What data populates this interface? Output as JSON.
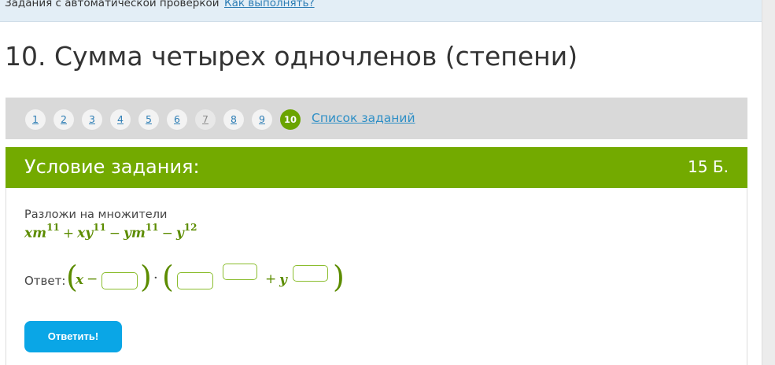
{
  "topbar": {
    "crumb": "Задания с автоматической проверкой",
    "help_link": "Как выполнять?"
  },
  "page_title": "10. Сумма четырех одночленов (степени)",
  "task_nav": {
    "items": [
      "1",
      "2",
      "3",
      "4",
      "5",
      "6",
      "7",
      "8",
      "9",
      "10"
    ],
    "active": "10",
    "list_link": "Список заданий"
  },
  "card": {
    "title": "Условие задания:",
    "points": "15 Б.",
    "prompt": "Разложи на множители",
    "expression": {
      "t1_base": "xm",
      "t1_exp": "11",
      "op1": "+",
      "t2_base": "xy",
      "t2_exp": "11",
      "op2": "−",
      "t3_base": "ym",
      "t3_exp": "11",
      "op3": "−",
      "t4_base": "y",
      "t4_exp": "12"
    },
    "answer_label": "Ответ:",
    "answer": {
      "x": "x",
      "minus": "−",
      "dot": "·",
      "plus": "+",
      "y": "y",
      "inputs": [
        "",
        "",
        "",
        ""
      ]
    },
    "submit": "Ответить!"
  },
  "colors": {
    "accent_green": "#73aa00",
    "math_green": "#5c8c00",
    "submit_blue": "#0aa6e6",
    "link_blue": "#2e7eb5"
  }
}
